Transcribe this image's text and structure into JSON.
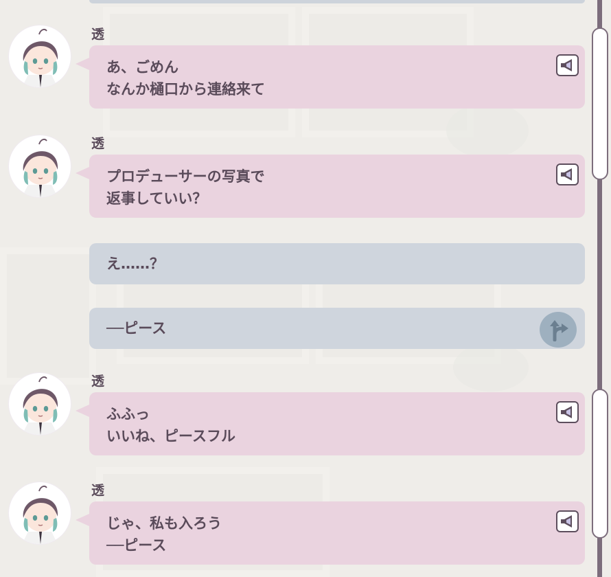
{
  "messages": [
    {
      "speaker": "透",
      "lines": [
        "あ、ごめん",
        "なんか樋口から連絡来て"
      ],
      "voice_icon": "speaker-icon"
    },
    {
      "speaker": "透",
      "lines": [
        "プロデューサーの写真で",
        "返事していい？"
      ],
      "voice_icon": "speaker-icon"
    },
    {
      "choice": "え……？"
    },
    {
      "choice": "──ピース",
      "choice_icon": "branch-arrow-icon"
    },
    {
      "speaker": "透",
      "lines": [
        "ふふっ",
        "いいね、ピースフル"
      ],
      "voice_icon": "speaker-icon"
    },
    {
      "speaker": "透",
      "lines": [
        "じゃ、私も入ろう",
        "──ピース"
      ],
      "voice_icon": "speaker-icon"
    }
  ],
  "colors": {
    "character_bubble": "#ead3df",
    "choice_bubble": "#cfd5dd",
    "text": "#5a4b5a",
    "scrollbar": "#7c6d7c"
  }
}
